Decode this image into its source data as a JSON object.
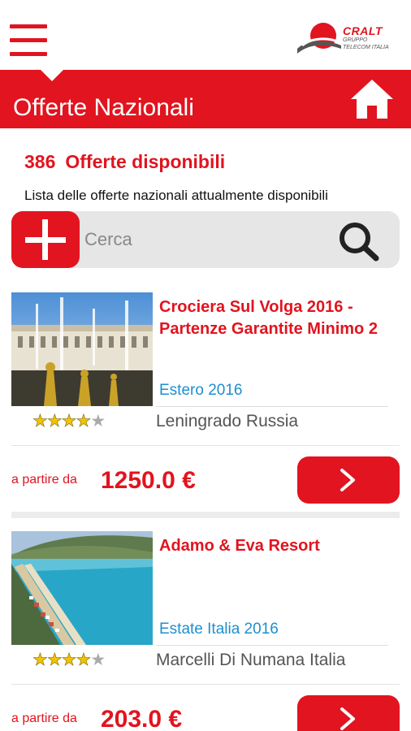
{
  "header": {
    "title": "Offerte Nazionali"
  },
  "logo": {
    "name": "CRALT",
    "line1": "GRUPPO",
    "line2": "TELECOM ITALIA"
  },
  "summary": {
    "count": "386",
    "label": "Offerte disponibili",
    "description": "Lista delle offerte nazionali attualmente disponibili"
  },
  "search": {
    "placeholder": "Cerca"
  },
  "colors": {
    "accent": "#e1141f",
    "category": "#1d8fd0",
    "star": "#f4c300"
  },
  "offers": [
    {
      "title": "Crociera Sul Volga 2016 - Partenze Garantite Minimo 2",
      "category": "Estero 2016",
      "location": "Leningrado Russia",
      "rating": 4,
      "rating_max": 5,
      "price_prefix": "a partire da",
      "price": "1250.0 €"
    },
    {
      "title": "Adamo & Eva Resort",
      "category": "Estate Italia 2016",
      "location": "Marcelli Di Numana Italia",
      "rating": 4,
      "rating_max": 5,
      "price_prefix": "a partire da",
      "price": "203.0 €"
    }
  ],
  "icons": {
    "menu": "hamburger-icon",
    "home": "home-icon",
    "add": "plus-icon",
    "search": "search-icon",
    "next": "chevron-right-icon"
  }
}
